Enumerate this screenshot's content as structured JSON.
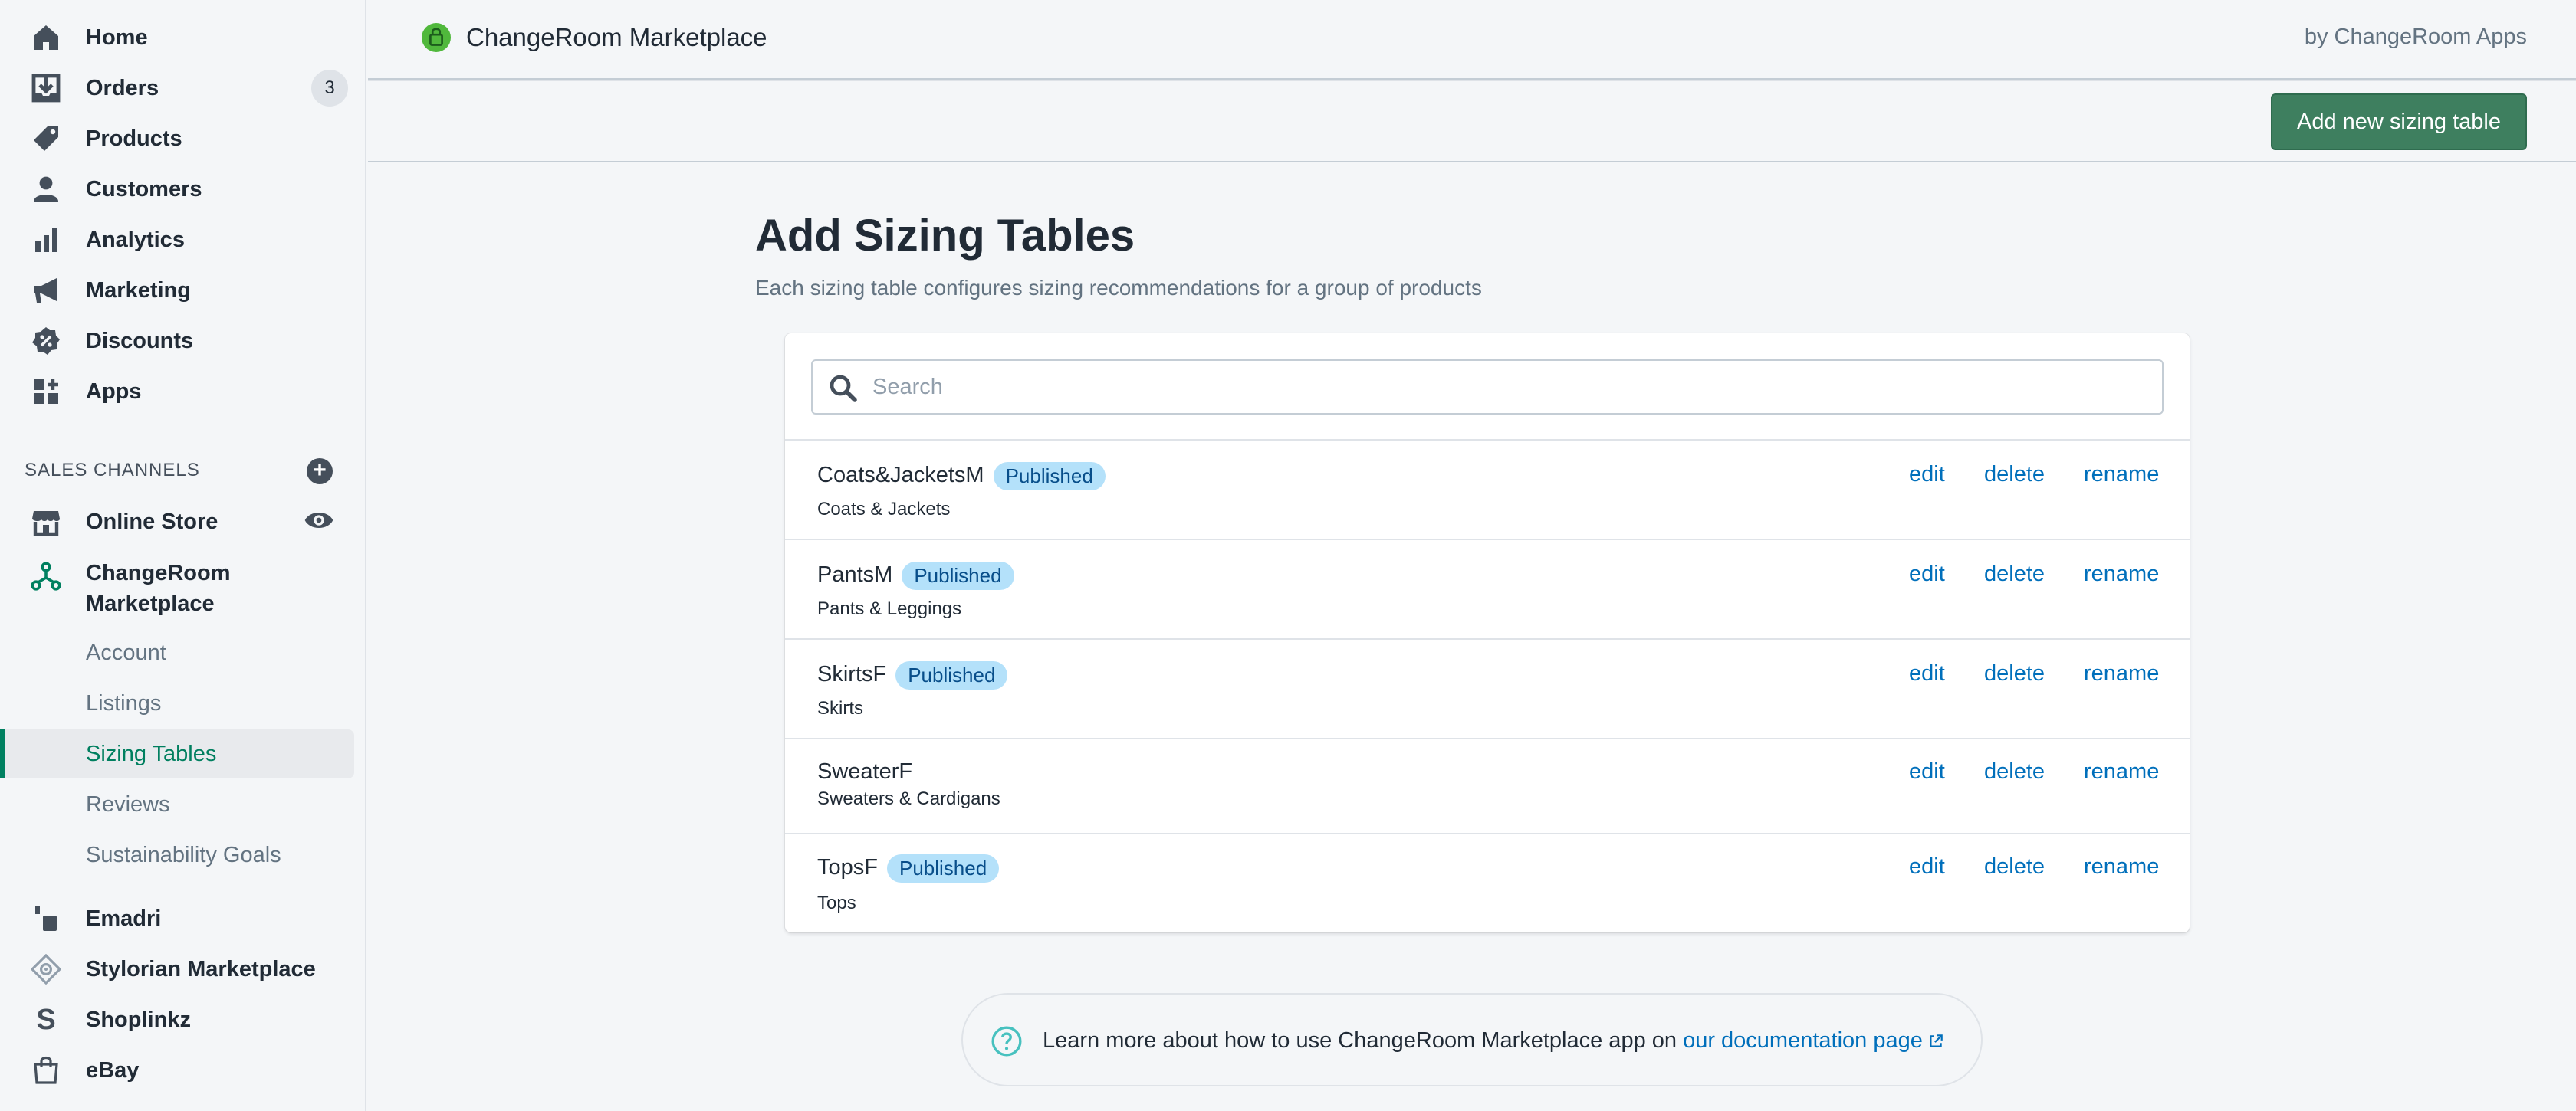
{
  "sidebar": {
    "items": [
      {
        "label": "Home",
        "icon": "home-icon"
      },
      {
        "label": "Orders",
        "icon": "orders-icon",
        "badge": "3"
      },
      {
        "label": "Products",
        "icon": "tag-icon"
      },
      {
        "label": "Customers",
        "icon": "person-icon"
      },
      {
        "label": "Analytics",
        "icon": "bar-chart-icon"
      },
      {
        "label": "Marketing",
        "icon": "megaphone-icon"
      },
      {
        "label": "Discounts",
        "icon": "discount-icon"
      },
      {
        "label": "Apps",
        "icon": "apps-icon"
      }
    ],
    "sales_channels_heading": "SALES CHANNELS",
    "online_store": "Online Store",
    "changeroom_line1": "ChangeRoom",
    "changeroom_line2": "Marketplace",
    "sub_items": [
      {
        "label": "Account"
      },
      {
        "label": "Listings"
      },
      {
        "label": "Sizing Tables"
      },
      {
        "label": "Reviews"
      },
      {
        "label": "Sustainability Goals"
      }
    ],
    "other_apps": [
      {
        "label": "Emadri"
      },
      {
        "label": "Stylorian Marketplace"
      },
      {
        "label": "Shoplinkz"
      },
      {
        "label": "eBay"
      }
    ]
  },
  "topbar": {
    "app_title": "ChangeRoom Marketplace",
    "by_line": "by ChangeRoom Apps",
    "add_button": "Add new sizing table"
  },
  "main": {
    "title": "Add Sizing Tables",
    "subtitle": "Each sizing table configures sizing recommendations for a group of products",
    "search_placeholder": "Search",
    "rows": [
      {
        "name": "Coats&JacketsM",
        "status": "Published",
        "category": "Coats & Jackets"
      },
      {
        "name": "PantsM",
        "status": "Published",
        "category": "Pants & Leggings"
      },
      {
        "name": "SkirtsF",
        "status": "Published",
        "category": "Skirts"
      },
      {
        "name": "SweaterF",
        "status": "",
        "category": "Sweaters & Cardigans"
      },
      {
        "name": "TopsF",
        "status": "Published",
        "category": "Tops"
      }
    ],
    "actions": {
      "edit": "edit",
      "delete": "delete",
      "rename": "rename"
    },
    "help_text": "Learn more about how to use ChangeRoom Marketplace app on ",
    "help_link": "our documentation page"
  },
  "colors": {
    "accent_green": "#3e7f5f",
    "link_blue": "#006fbb",
    "badge_blue": "#b4e1fa"
  }
}
